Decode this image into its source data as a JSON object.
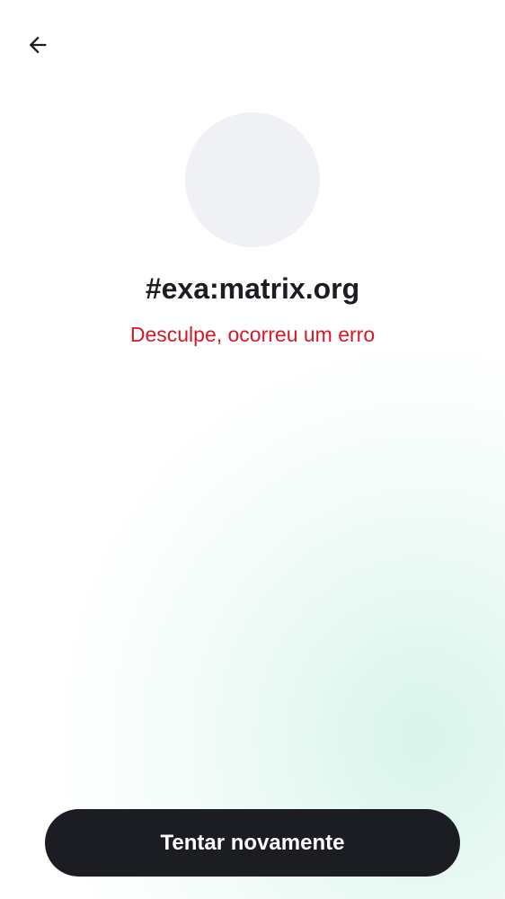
{
  "header": {
    "back_icon": "arrow-left-icon"
  },
  "room": {
    "title": "#exa:matrix.org",
    "error_message": "Desculpe, ocorreu um erro"
  },
  "actions": {
    "retry_label": "Tentar novamente"
  },
  "colors": {
    "text_primary": "#1b1d22",
    "error": "#d51928",
    "avatar_placeholder": "#f0f1f5",
    "button_bg": "#1b1d22",
    "button_text": "#ffffff"
  }
}
